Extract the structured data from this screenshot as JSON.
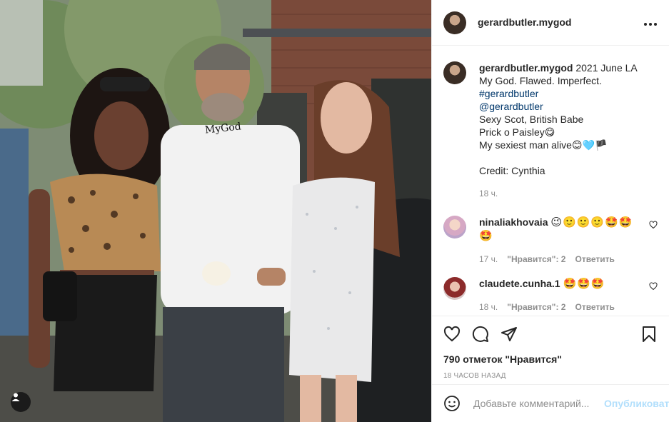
{
  "colors": {
    "text": "#262626",
    "muted": "#8e8e8e",
    "link": "#00376b",
    "publish_disabled": "#b2dffc",
    "border": "#efefef"
  },
  "photo": {
    "overlay_text": "MyGod"
  },
  "header": {
    "username": "gerardbutler.mygod",
    "more_icon": "more-horizontal-icon"
  },
  "caption": {
    "username": "gerardbutler.mygod",
    "lines": [
      "2021 June LA",
      "My God. Flawed. Imperfect.",
      "#gerardbutler",
      "@gerardbutler",
      "Sexy Scot, British Babe",
      "Prick o Paisley😋",
      "My sexiest man alive😊🩵🏴",
      "Credit: Cynthia"
    ],
    "time": "18 ч."
  },
  "comments": [
    {
      "username": "ninaliakhovaia",
      "text": "😉🙂🙂🙂🤩🤩🤩",
      "time": "17 ч.",
      "likes": "\"Нравится\": 2",
      "reply": "Ответить"
    },
    {
      "username": "claudete.cunha.1",
      "text": "🤩🤩🤩",
      "time": "18 ч.",
      "likes": "\"Нравится\": 2",
      "reply": "Ответить"
    }
  ],
  "actions": {
    "likes_text": "790 отметок \"Нравится\"",
    "timestamp": "18 часов назад"
  },
  "add_comment": {
    "placeholder": "Добавьте комментарий...",
    "publish": "Опубликовать"
  }
}
